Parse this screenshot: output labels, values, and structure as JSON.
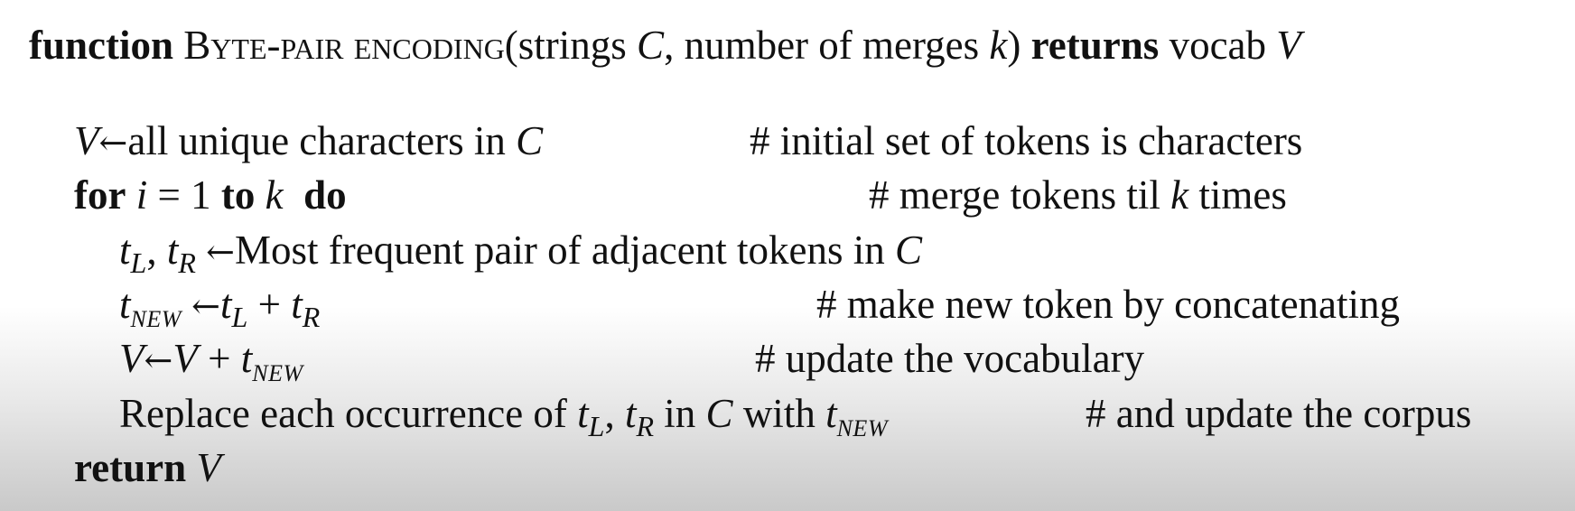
{
  "header": {
    "keyword_function": "function",
    "name": "Byte-pair encoding",
    "params_open": "(strings ",
    "param_C": "C",
    "params_mid": ", number of merges ",
    "param_k": "k",
    "params_close": ")",
    "keyword_returns": "returns",
    "return_text": "vocab",
    "return_var": "V"
  },
  "lines": {
    "l1": {
      "var": "V",
      "arrow": "←",
      "text": "all unique characters in ",
      "C": "C",
      "comment": "# initial set of tokens is characters"
    },
    "l2": {
      "kw_for": "for",
      "var_i": "i",
      "eq": " = 1 ",
      "kw_to": "to",
      "var_k": "k",
      "kw_do": "do",
      "comment_pre": "# merge tokens til ",
      "comment_k": "k",
      "comment_post": " times"
    },
    "l3": {
      "t": "t",
      "L": "L",
      "comma": ", ",
      "t2": "t",
      "R": "R",
      "arrow": "←",
      "text": "Most frequent pair of adjacent tokens in ",
      "C": "C"
    },
    "l4": {
      "t": "t",
      "NEW": "NEW",
      "arrow": "←",
      "t2": "t",
      "L": "L",
      "plus": " + ",
      "t3": "t",
      "R": "R",
      "comment": "# make new token by concatenating"
    },
    "l5": {
      "V": "V",
      "arrow": "←",
      "V2": "V",
      "plus": " + ",
      "t": "t",
      "NEW": "NEW",
      "comment": "# update the vocabulary"
    },
    "l6": {
      "text_a": "Replace each occurrence of ",
      "t": "t",
      "L": "L",
      "comma": ", ",
      "t2": "t",
      "R": "R",
      "text_b": " in ",
      "C": "C",
      "text_c": " with ",
      "t3": "t",
      "NEW": "NEW",
      "comment": "# and update the corpus"
    },
    "l7": {
      "kw_return": "return",
      "var": "V"
    }
  }
}
